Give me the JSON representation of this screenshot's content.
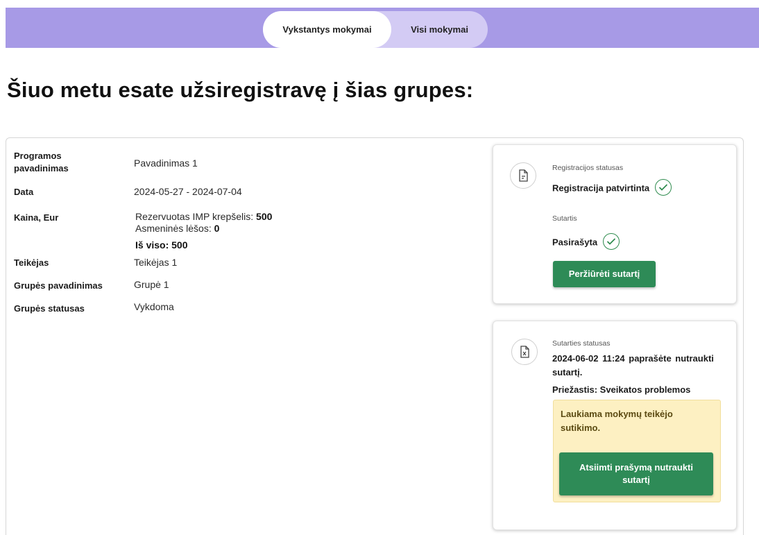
{
  "tabs": {
    "active_label": "Vykstantys mokymai",
    "inactive_label": "Visi mokymai"
  },
  "page_title": "Šiuo metu esate užsiregistravę į šias grupes:",
  "details": {
    "program_label": "Programos pavadinimas",
    "program_value": "Pavadinimas 1",
    "date_label": "Data",
    "date_value": "2024-05-27 - 2024-07-04",
    "price_label": "Kaina, Eur",
    "price_reserved_text": "Rezervuotas IMP krepšelis:",
    "price_reserved_value": "500",
    "price_own_text": "Asmeninės lėšos:",
    "price_own_value": "0",
    "price_total_text": "Iš viso: 500",
    "provider_label": "Teikėjas",
    "provider_value": "Teikėjas 1",
    "group_name_label": "Grupės pavadinimas",
    "group_name_value": "Grupė 1",
    "group_status_label": "Grupės statusas",
    "group_status_value": "Vykdoma"
  },
  "registration": {
    "status_caption": "Registracijos statusas",
    "status_value": "Registracija patvirtinta",
    "contract_caption": "Sutartis",
    "contract_value": "Pasirašyta",
    "view_contract_button": "Peržiūrėti sutartį"
  },
  "contract_status": {
    "caption": "Sutarties statusas",
    "message": "2024-06-02  11:24  paprašėte nutraukti sutartį.",
    "reason": "Priežastis: Sveikatos problemos",
    "warning": "Laukiama mokymų teikėjo sutikimo.",
    "withdraw_button": "Atsiimti prašymą nutraukti sutartį"
  },
  "colors": {
    "topbar": "#a79ae6",
    "tab_inactive": "#d3cbf4",
    "green": "#2e8b57",
    "warning_bg": "#fdf0c2"
  }
}
